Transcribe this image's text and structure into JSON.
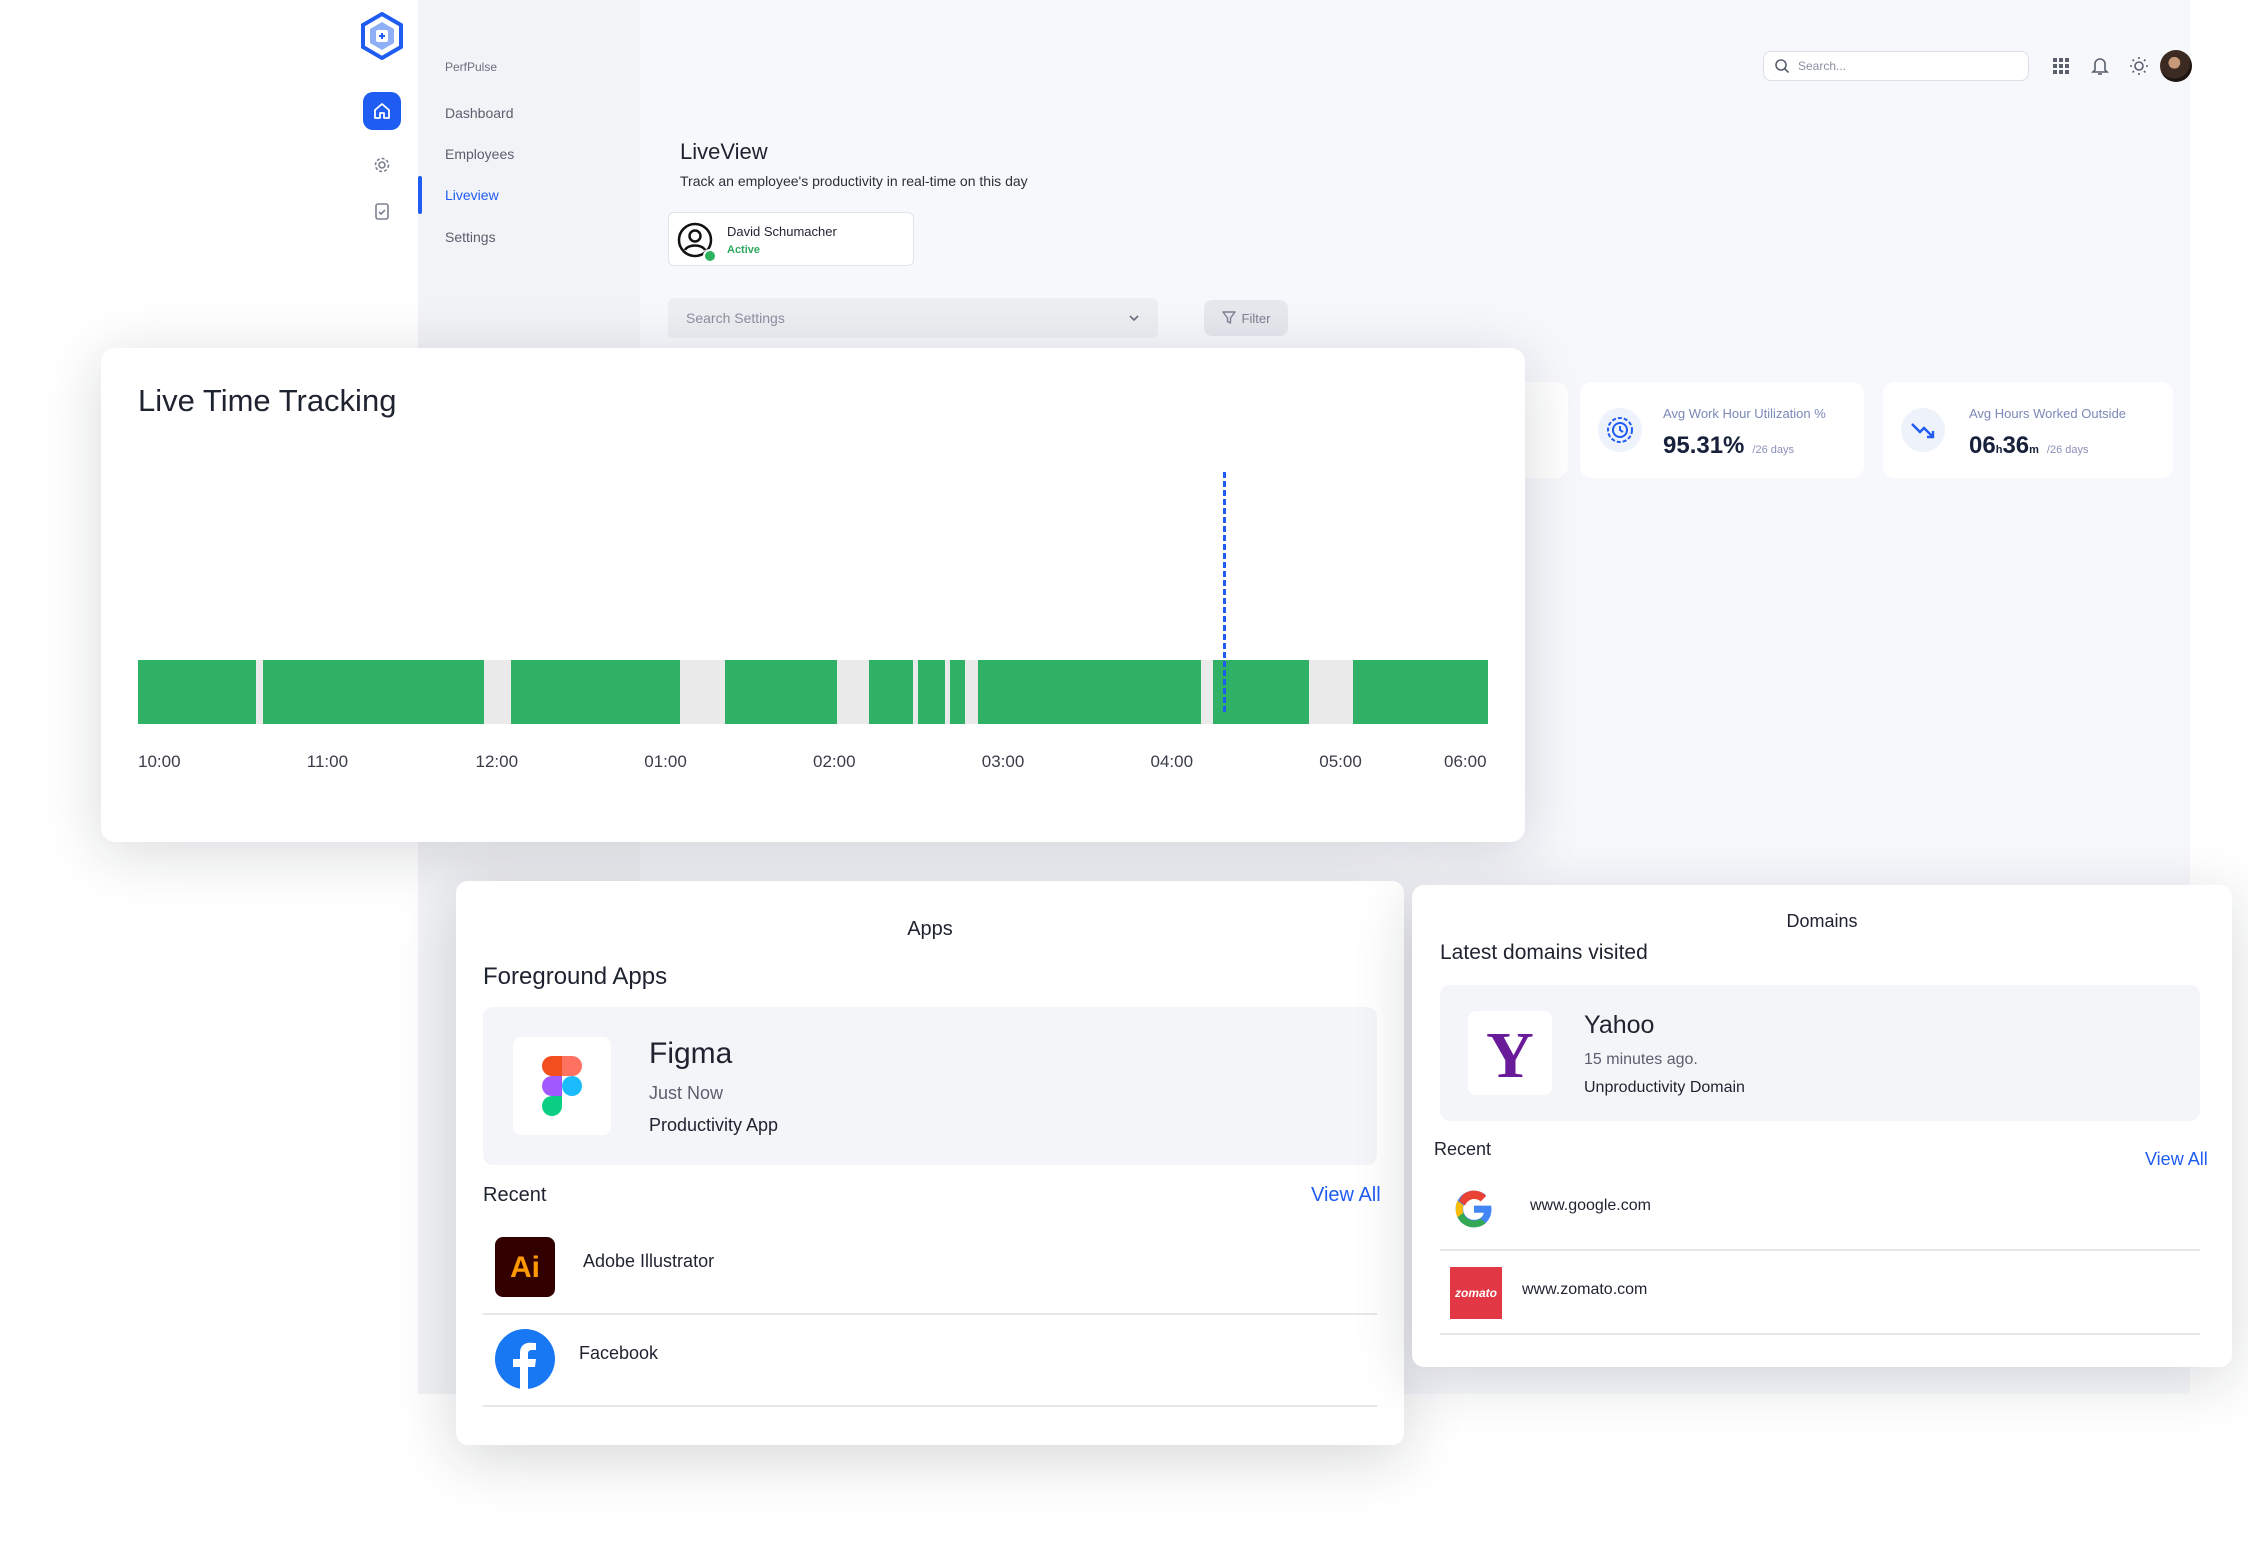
{
  "app": {
    "name": "PerfPulse",
    "nav": [
      "Dashboard",
      "Employees",
      "Liveview",
      "Settings"
    ],
    "active_nav": "Liveview"
  },
  "header": {
    "search_placeholder": "Search..."
  },
  "page": {
    "title": "LiveView",
    "subtitle": "Track an employee's productivity in real-time on this day",
    "employee": {
      "name": "David Schumacher",
      "status": "Active"
    },
    "search_settings_placeholder": "Search Settings",
    "filter_label": "Filter"
  },
  "stats": [
    {
      "label": "Avg Work Hour Utilization %",
      "value": "95.31%",
      "sub": "/26 days"
    },
    {
      "label": "Avg Hours Worked Outside",
      "hours": "06",
      "h_unit": "h",
      "minutes": "36",
      "m_unit": "m",
      "sub": "/26 days"
    }
  ],
  "live_tracking": {
    "title": "Live Time Tracking",
    "ticks": [
      "10:00",
      "11:00",
      "12:00",
      "01:00",
      "02:00",
      "03:00",
      "04:00",
      "05:00",
      "06:00"
    ],
    "active_segments_hours": [
      [
        0,
        0.7
      ],
      [
        0.74,
        2.05
      ],
      [
        2.21,
        3.21
      ],
      [
        3.48,
        4.14
      ],
      [
        4.33,
        4.59
      ],
      [
        4.62,
        4.78
      ],
      [
        4.81,
        4.9
      ],
      [
        4.98,
        6.3
      ],
      [
        6.37,
        6.94
      ],
      [
        7.2,
        8.0
      ]
    ],
    "current_time_hours": 6.43,
    "colors": {
      "active": "#2fb265",
      "idle": "#eaeaea",
      "now_line": "#1f5cf2"
    }
  },
  "apps": {
    "heading": "Apps",
    "foreground_title": "Foreground Apps",
    "foreground": {
      "name": "Figma",
      "time": "Just Now",
      "type": "Productivity App"
    },
    "recent_label": "Recent",
    "view_all": "View All",
    "recent": [
      {
        "name": "Adobe Illustrator",
        "icon": "adobe-illustrator-icon"
      },
      {
        "name": "Facebook",
        "icon": "facebook-icon"
      }
    ]
  },
  "domains": {
    "heading": "Domains",
    "latest_title": "Latest domains visited",
    "latest": {
      "name": "Yahoo",
      "time": "15 minutes ago.",
      "type": "Unproductivity Domain"
    },
    "recent_label": "Recent",
    "view_all": "View All",
    "recent": [
      {
        "name": "www.google.com",
        "icon": "google-icon"
      },
      {
        "name": "www.zomato.com",
        "icon": "zomato-icon",
        "logo_text": "zomato"
      }
    ]
  }
}
